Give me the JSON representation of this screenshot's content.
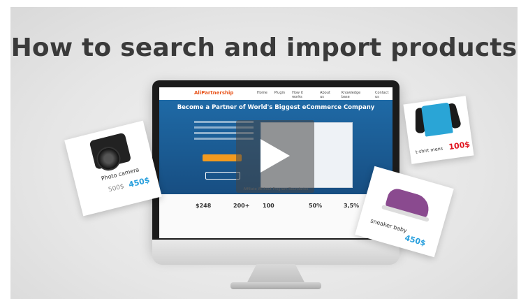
{
  "headline": "How to search and import products",
  "site": {
    "logo": "AliPartnership",
    "menu": [
      "Home",
      "Plugin",
      "How it works",
      "About us",
      "Knowledge base",
      "Contact us"
    ],
    "hero_title": "Become a Partner of World's Biggest eCommerce Company",
    "subtitle": "Affiliate Without Program Boundaries",
    "stats": [
      "$248",
      "200+",
      "100",
      "50%",
      "3,5%"
    ]
  },
  "products": {
    "camera": {
      "label": "Photo camera",
      "old_price": "500$",
      "new_price": "450$"
    },
    "shirt": {
      "label": "t-shirt mens",
      "new_price": "100$"
    },
    "sneaker": {
      "label": "sneaker baby",
      "new_price": "450$"
    }
  },
  "icons": {
    "play": "play-icon",
    "apple": "apple-icon"
  },
  "colors": {
    "price_red": "#e0141e",
    "price_blue": "#2aa0dd",
    "accent_orange": "#f29a1f"
  }
}
